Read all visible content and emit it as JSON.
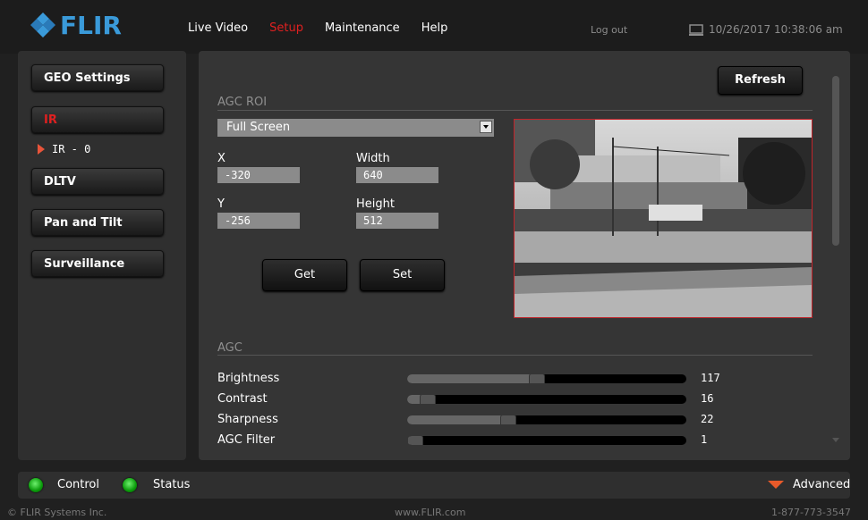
{
  "brand": {
    "logo_text": "FLIR",
    "accent": "#3a9ad9"
  },
  "nav": {
    "items": [
      {
        "label": "Live Video",
        "active": false
      },
      {
        "label": "Setup",
        "active": true
      },
      {
        "label": "Maintenance",
        "active": false
      },
      {
        "label": "Help",
        "active": false
      }
    ],
    "logout": "Log out",
    "datetime": "10/26/2017 10:38:06 am"
  },
  "sidebar": {
    "items": [
      {
        "label": "GEO Settings"
      },
      {
        "label": "IR"
      },
      {
        "label": "DLTV"
      },
      {
        "label": "Pan and Tilt"
      },
      {
        "label": "Surveillance"
      }
    ],
    "sub_item": "IR - 0"
  },
  "main": {
    "refresh_label": "Refresh",
    "agc_roi_title": "AGC ROI",
    "roi_mode": "Full Screen",
    "x_label": "X",
    "x_value": "-320",
    "width_label": "Width",
    "width_value": "640",
    "y_label": "Y",
    "y_value": "-256",
    "height_label": "Height",
    "height_value": "512",
    "get_label": "Get",
    "set_label": "Set",
    "agc_title": "AGC",
    "sliders": [
      {
        "label": "Brightness",
        "value": "117",
        "fraction": 0.46
      },
      {
        "label": "Contrast",
        "value": "16",
        "fraction": 0.07
      },
      {
        "label": "Sharpness",
        "value": "22",
        "fraction": 0.36
      },
      {
        "label": "AGC Filter",
        "value": "1",
        "fraction": 0.01
      }
    ]
  },
  "footer": {
    "control_label": "Control",
    "status_label": "Status",
    "advanced_label": "Advanced",
    "copyright": "© FLIR Systems Inc.",
    "website": "www.FLIR.com",
    "phone": "1-877-773-3547"
  }
}
